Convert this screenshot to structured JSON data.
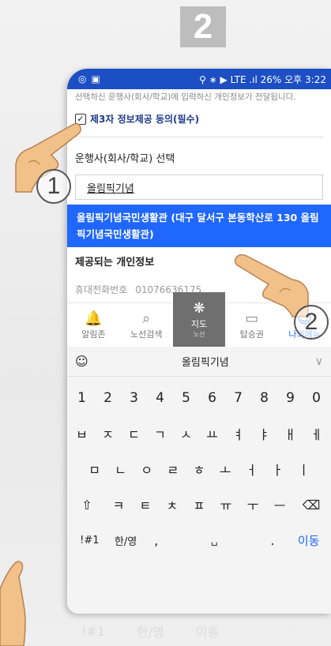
{
  "step_number": "2",
  "status_bar": {
    "left_icons": [
      "headset-icon",
      "image-icon"
    ],
    "right_text": "26% 오후 3:22"
  },
  "notice": "선택하신 운행사(회사/학교)에 입력하신 개인정보가 전달됩니다.",
  "consent": {
    "checked": true,
    "label": "제3자 정보제공 동의(필수)"
  },
  "operator_section_label": "운행사(회사/학교) 선택",
  "search": {
    "value": "올림픽기념"
  },
  "suggestion": "올림픽기념국민생활관 (대구 달서구 본동학산로 130 올림픽기념국민생활관)",
  "provided_info_label": "제공되는 개인정보",
  "phone_row": {
    "label": "휴대전화번호",
    "value": "01076636175"
  },
  "bottom_nav": {
    "items": [
      {
        "icon": "bell-icon",
        "label": "알림존"
      },
      {
        "icon": "bus-search-icon",
        "label": "노선검색"
      },
      {
        "icon": "map-icon",
        "label": "지도",
        "sub": "노선"
      },
      {
        "icon": "ticket-icon",
        "label": "탑승권"
      },
      {
        "icon": "person-icon",
        "label": "나의메뉴"
      }
    ]
  },
  "keyboard": {
    "suggestion": "올림픽기념",
    "numbers": [
      "1",
      "2",
      "3",
      "4",
      "5",
      "6",
      "7",
      "8",
      "9",
      "0"
    ],
    "row1": [
      "ㅂ",
      "ㅈ",
      "ㄷ",
      "ㄱ",
      "ㅅ",
      "ㅛ",
      "ㅕ",
      "ㅑ",
      "ㅐ",
      "ㅔ"
    ],
    "row2": [
      "ㅁ",
      "ㄴ",
      "ㅇ",
      "ㄹ",
      "ㅎ",
      "ㅗ",
      "ㅓ",
      "ㅏ",
      "ㅣ"
    ],
    "row3": [
      "ㅋ",
      "ㅌ",
      "ㅊ",
      "ㅍ",
      "ㅠ",
      "ㅜ",
      "ㅡ"
    ],
    "symbols": "!#1",
    "lang": "한/영",
    "comma": ",",
    "period": ".",
    "enter": "이동"
  },
  "markers": [
    "1",
    "2"
  ]
}
